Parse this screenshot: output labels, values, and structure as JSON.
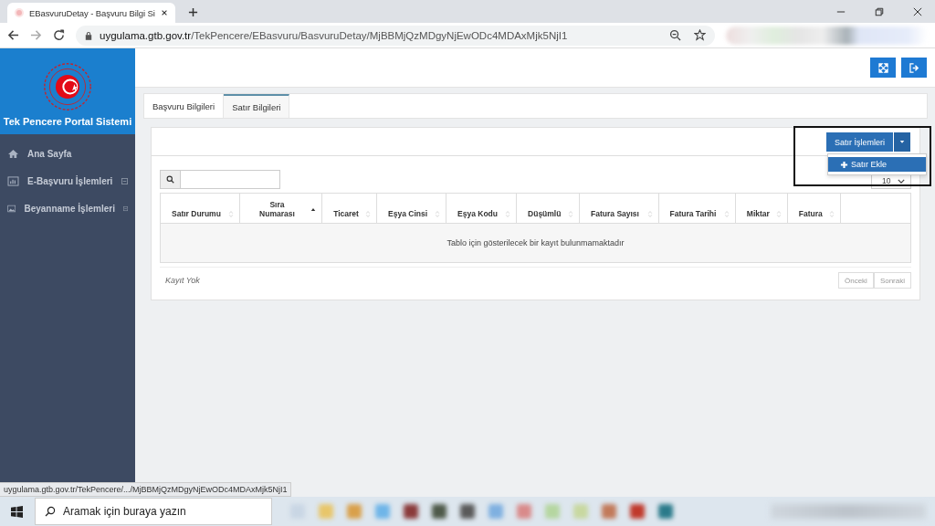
{
  "browser": {
    "tab_title": "EBasvuruDetay - Başvuru Bilgi Si",
    "url_host": "uygulama.gtb.gov.tr",
    "url_path": "/TekPencere/EBasvuru/BasvuruDetay/MjBBMjQzMDgyNjEwODc4MDAxMjk5NjI1"
  },
  "sidebar": {
    "title": "Tek Pencere Portal Sistemi",
    "items": [
      {
        "label": "Ana Sayfa",
        "kind": "home",
        "expandable": false
      },
      {
        "label": "E-Başvuru İşlemleri",
        "kind": "chart",
        "expandable": true
      },
      {
        "label": "Beyanname İşlemleri",
        "kind": "image",
        "expandable": true
      }
    ]
  },
  "tabs": [
    {
      "label": "Başvuru Bilgileri",
      "selected": false
    },
    {
      "label": "Satır Bilgileri",
      "selected": true
    }
  ],
  "actions": {
    "button": "Satır İşlemleri",
    "menu": [
      {
        "label": "Satır Ekle",
        "selected": true
      }
    ]
  },
  "page_size": "10",
  "table": {
    "columns": [
      {
        "label": "Satır Durumu",
        "sorted": false
      },
      {
        "label": "Sıra Numarası",
        "sorted": true
      },
      {
        "label": "Ticaret",
        "sorted": false
      },
      {
        "label": "Eşya Cinsi",
        "sorted": false
      },
      {
        "label": "Eşya Kodu",
        "sorted": false
      },
      {
        "label": "Düşümlü",
        "sorted": false
      },
      {
        "label": "Fatura Sayısı",
        "sorted": false
      },
      {
        "label": "Fatura Tarihi",
        "sorted": false
      },
      {
        "label": "Miktar",
        "sorted": false
      },
      {
        "label": "Fatura",
        "sorted": false
      }
    ],
    "empty_message": "Tablo için gösterilecek bir kayıt bulunmamaktadır"
  },
  "footer": {
    "info": "Kayıt Yok",
    "buttons": [
      "Önceki",
      "Sonraki"
    ]
  },
  "status_url": "uygulama.gtb.gov.tr/TekPencere/.../MjBBMjQzMDgyNjEwODc4MDAxMjk5NjI1",
  "taskbar": {
    "search_placeholder": "Aramak için buraya yazın"
  }
}
